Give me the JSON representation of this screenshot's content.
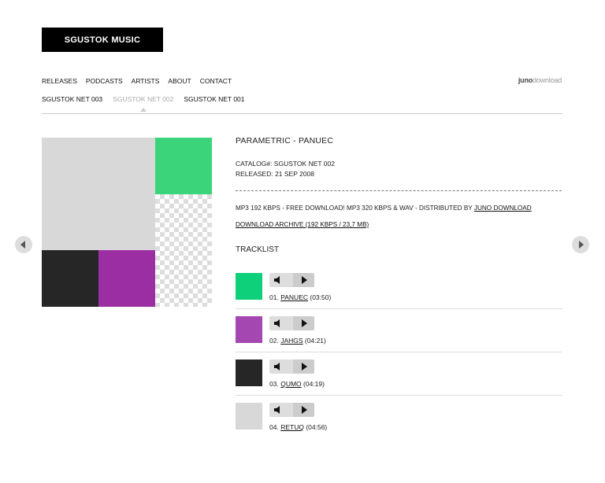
{
  "brand": {
    "logo_text": "SGUSTOK MUSIC"
  },
  "nav": {
    "items": [
      "RELEASES",
      "PODCASTS",
      "ARTISTS",
      "ABOUT",
      "CONTACT"
    ]
  },
  "partner": {
    "strong": "juno",
    "light": "download"
  },
  "subnav": {
    "items": [
      "SGUSTOK NET 003",
      "SGUSTOK NET 002",
      "SGUSTOK NET 001"
    ],
    "active_index": 1
  },
  "release": {
    "title": "PARAMETRIC - PANUEC",
    "catalog": "CATALOG#: SGUSTOK NET 002",
    "released": "RELEASED: 21 SEP 2008",
    "formats_text": "MP3 192 KBPS - FREE DOWNLOAD! MP3 320 KBPS & WAV - DISTRIBUTED BY ",
    "formats_link": "JUNO DOWNLOAD",
    "archive_link": "DOWNLOAD ARCHIVE (192 KBPS / 23,7 MB)",
    "tracklist_title": "TRACKLIST"
  },
  "artwork_colors": {
    "gray": "#d8d8d8",
    "green": "#3bd47a",
    "dark": "#262626",
    "purple": "#9b2ea3"
  },
  "tracks": [
    {
      "num": "01.",
      "title": "PANUEC",
      "duration": "(03:50)",
      "color": "#0ecf7a"
    },
    {
      "num": "02.",
      "title": "JAHGS",
      "duration": "(04:21)",
      "color": "#a547b0"
    },
    {
      "num": "03.",
      "title": "QUMO",
      "duration": "(04:19)",
      "color": "#262626"
    },
    {
      "num": "04.",
      "title": "RETUQ",
      "duration": "(04:56)",
      "color": "#d8d8d8"
    }
  ],
  "icons": {
    "prev": "chevron-left-icon",
    "next": "chevron-right-icon",
    "volume": "speaker-icon",
    "play": "play-icon"
  }
}
